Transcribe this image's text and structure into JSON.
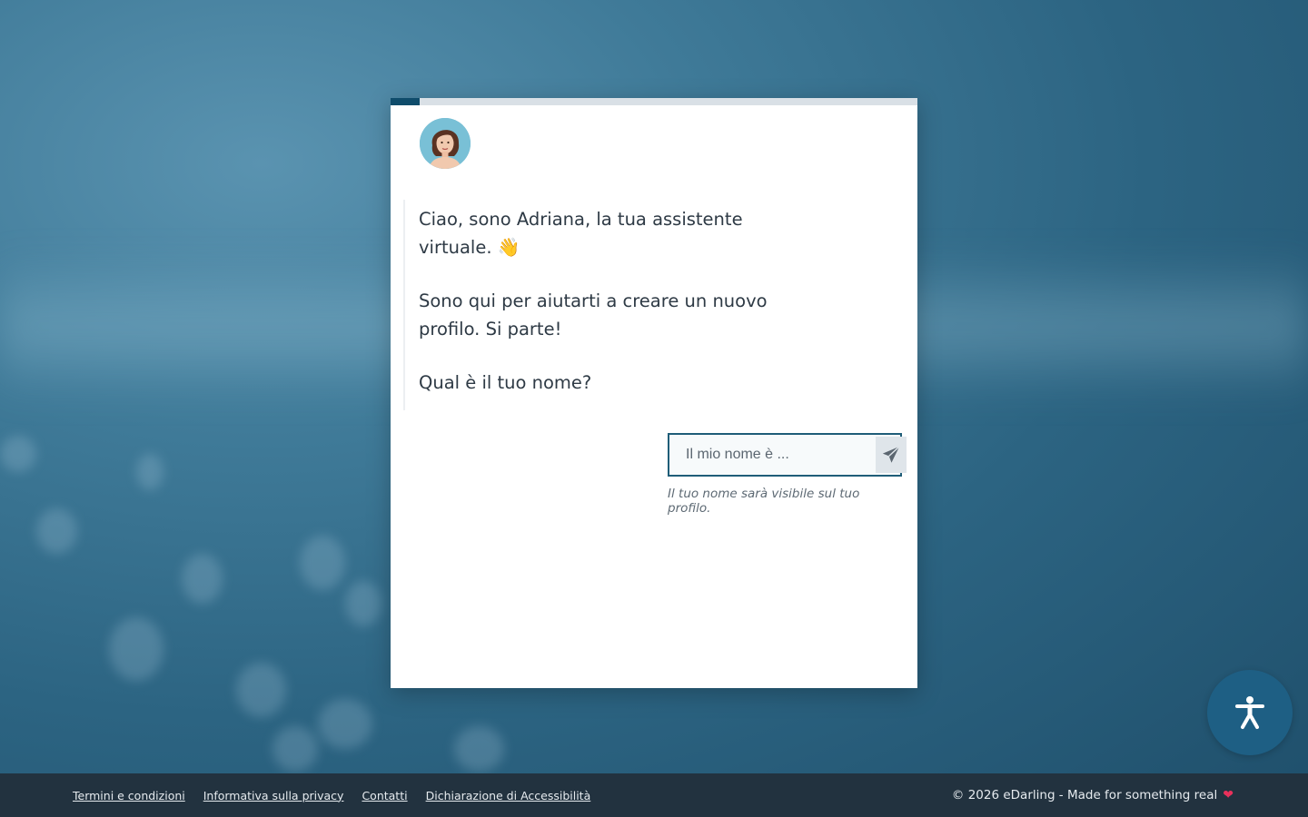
{
  "onboarding": {
    "progress_percent": 5.5,
    "assistant_avatar": "assistant-portrait",
    "messages": [
      "Ciao, sono Adriana, la tua assistente virtuale.",
      "Sono qui per aiutarti a creare un nuovo profilo. Si parte!",
      "Qual è il tuo nome?"
    ],
    "wave_emoji": "👋",
    "name_input": {
      "value": "",
      "placeholder": "Il mio nome è ..."
    },
    "send_icon": "paper-plane-icon",
    "hint": "Il tuo nome sarà visibile sul tuo profilo."
  },
  "accessibility": {
    "icon": "accessibility-icon"
  },
  "footer": {
    "links": [
      "Termini e condizioni",
      "Informativa sulla privacy",
      "Contatti",
      "Dichiarazione di Accessibilità"
    ],
    "copyright": "© 2026 eDarling - Made for something real",
    "heart_icon": "heart-icon"
  },
  "colors": {
    "accent": "#0f4c6b",
    "footer_bg": "#22323f",
    "accessibility_bg": "#1e5f84",
    "heart": "#e8315b"
  }
}
